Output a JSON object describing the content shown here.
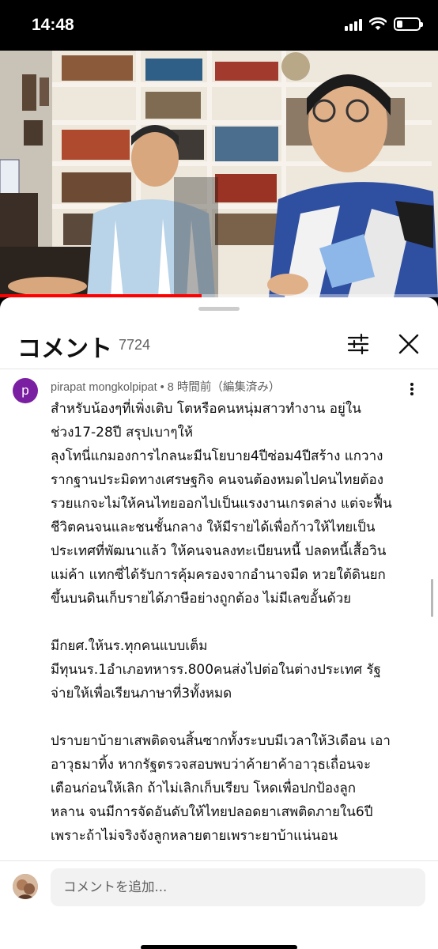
{
  "status_bar": {
    "time": "14:48",
    "battery_level_pct": 28
  },
  "video": {
    "progress_fraction": 0.46
  },
  "comments_panel": {
    "title": "コメント",
    "count": "7724",
    "filter_icon": "sliders-icon",
    "close_icon": "close-icon"
  },
  "comment": {
    "avatar_letter": "p",
    "author": "pirapat mongkolpipat",
    "time": "• 8 時間前（編集済み）",
    "paragraphs": [
      [
        "สำหรับน้องๆที่เพิ่งเติบ โตหรือคนหนุ่มสาวทำงาน อยู่ใน",
        "ช่วง17-28ปี สรุปเบาๆให้",
        " ลุงโทนี่แกมองการไกลนะมีนโยบาย4ปีซ่อม4ปีสร้าง แกวาง",
        "รากฐานประมิดทางเศรษฐกิจ คนจนต้องหมดไปคนไทยต้อง",
        "รวยแกจะไม่ให้คนไทยออกไปเป็นแรงงานเกรดล่าง แต่จะฟื้น",
        "ชีวิตคนจนและชนชั้นกลาง ให้มีรายได้เพื่อก้าวให้ไทยเป็น",
        "ประเทศที่พัฒนาแล้ว ให้คนจนลงทะเบียนหนี้ ปลดหนี้เสื้อวิน",
        "แม่ค้า แทกซี่ได้รับการคุ้มครองจากอำนาจมืด หวยใต้ดินยก",
        "ขึ้นบนดินเก็บรายได้ภาษีอย่างถูกต้อง ไม่มีเลขอั้นด้วย"
      ],
      [
        "มีกยศ.ให้นร.ทุกคนแบบเต็ม",
        "มีทุนนร.1อำเภอทหารร.800คนส่งไปต่อในต่างประเทศ รัฐ",
        "จ่ายให้เพื่อเรียนภาษาที่3ทั้งหมด"
      ],
      [
        "ปราบยาบ้ายาเสพติดจนสิ้นซากทั้งระบบมีเวลาให้3เดือน เอา",
        "อาวุธมาทิ้ง หากรัฐตรวจสอบพบว่าค้ายาค้าอาวุธเถื่อนจะ",
        "เตือนก่อนให้เลิก ถ้าไม่เลิกเก็บเรียบ โหดเพื่อปกป้องลูก",
        "หลาน จนมีการจัดอันดับให้ไทยปลอดยาเสพติดภายใน6ปี",
        "เพราะถ้าไม่จริงจังลูกหลายตายเพราะยาบ้าแน่นอน"
      ]
    ]
  },
  "composer": {
    "placeholder": "コメントを追加..."
  }
}
